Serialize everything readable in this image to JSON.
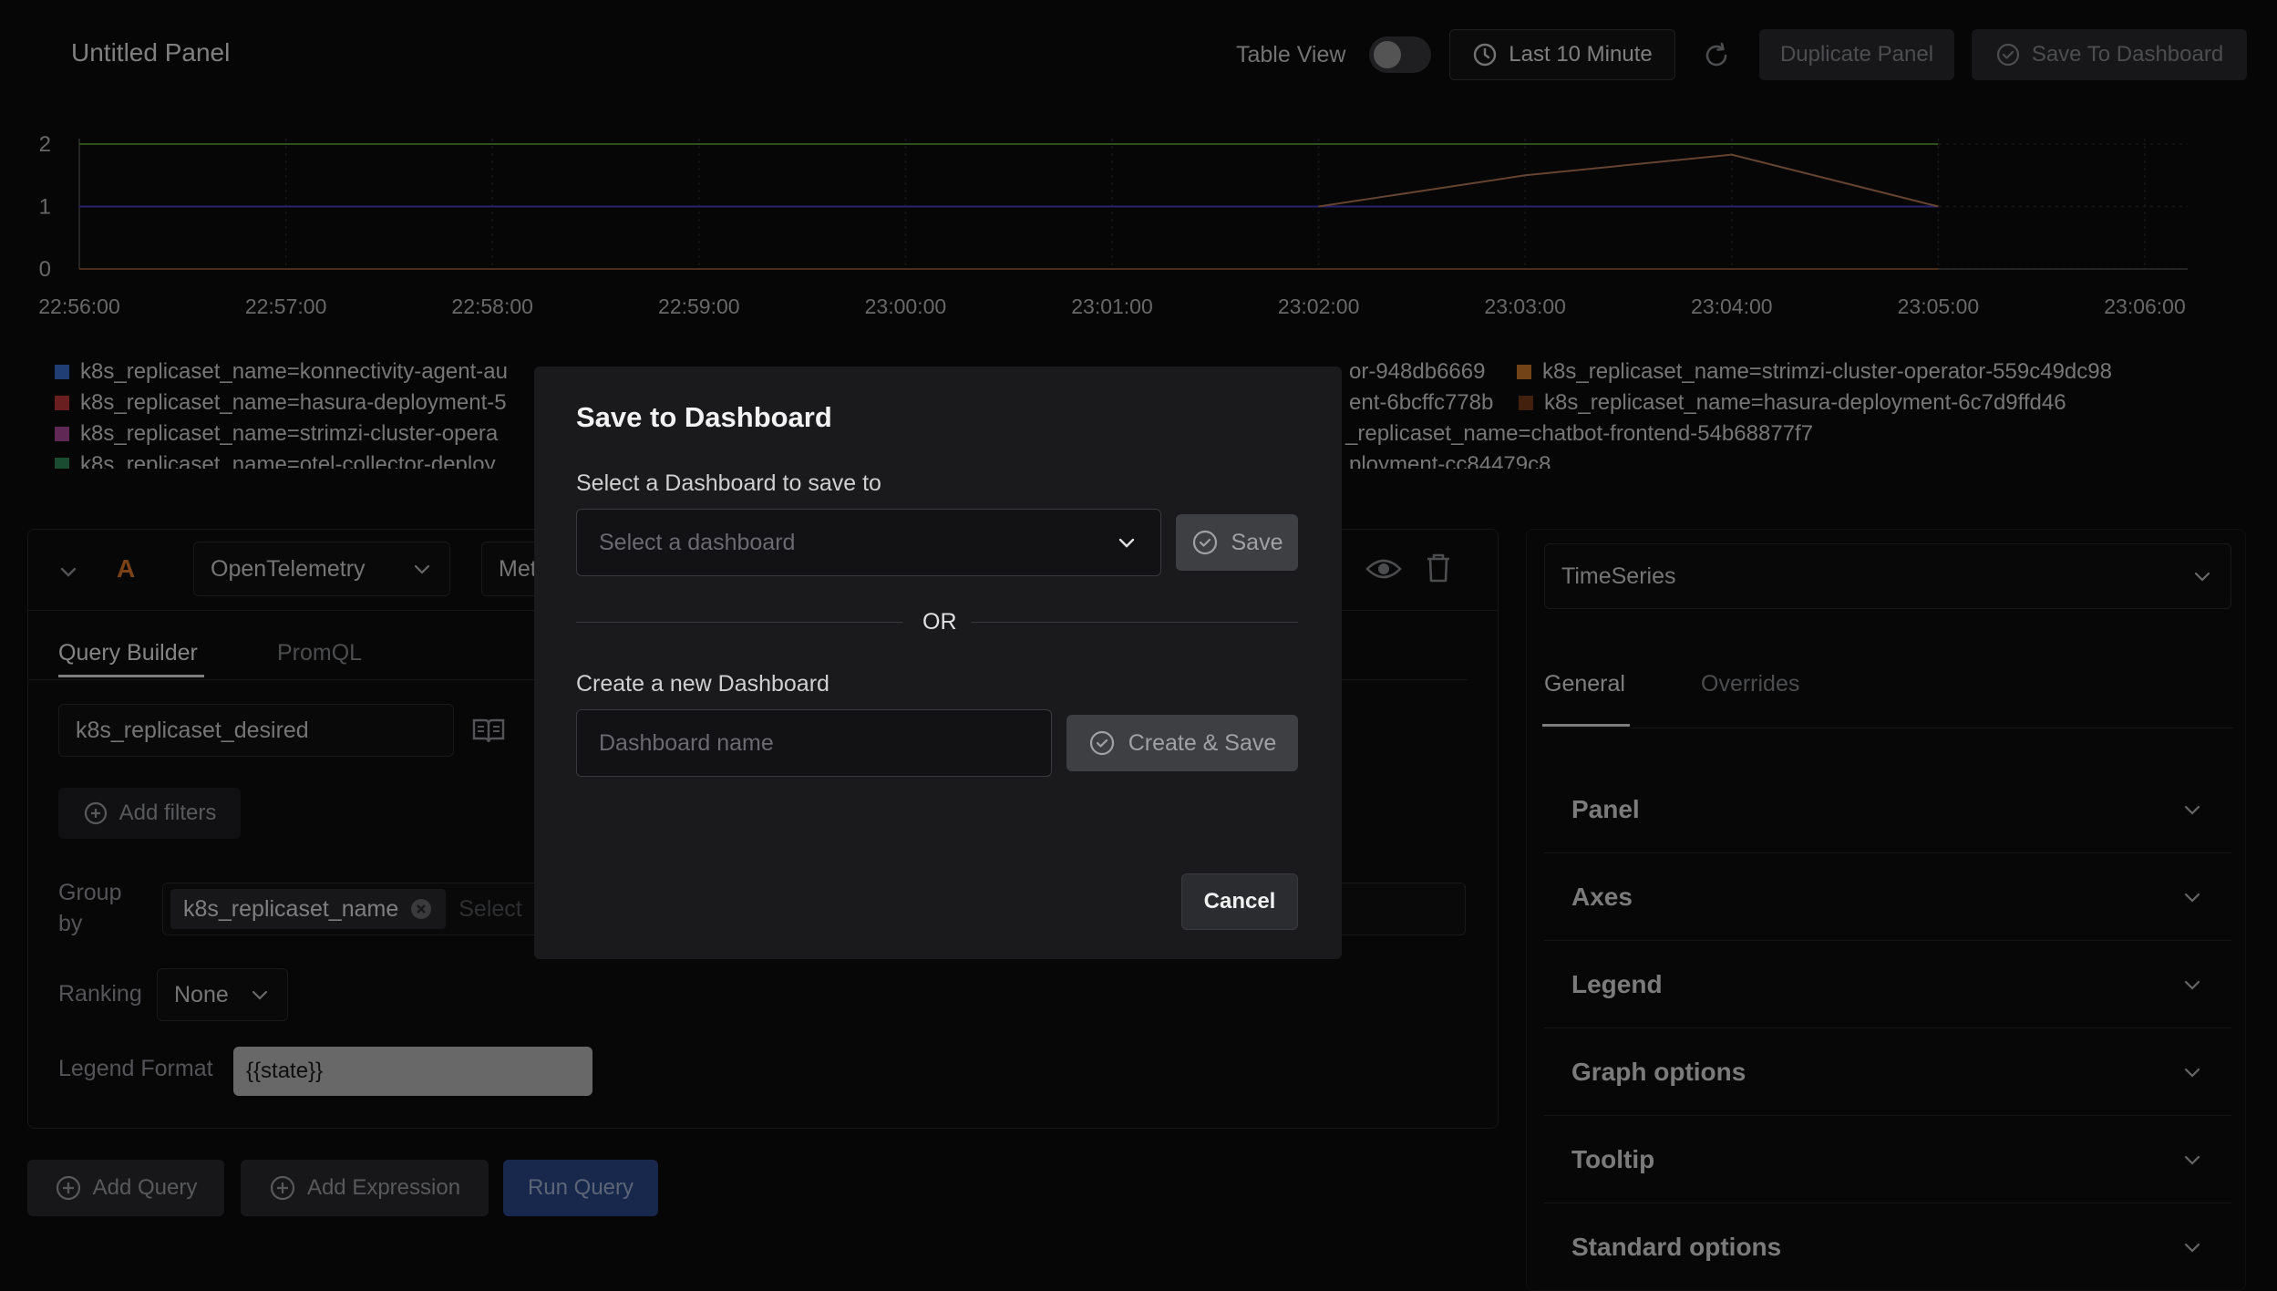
{
  "header": {
    "title": "Untitled Panel",
    "table_view_label": "Table View",
    "time_range": "Last 10 Minute",
    "duplicate_label": "Duplicate Panel",
    "save_label": "Save To Dashboard"
  },
  "chart_data": {
    "type": "line",
    "x": [
      "22:56:00",
      "22:57:00",
      "22:58:00",
      "22:59:00",
      "23:00:00",
      "23:01:00",
      "23:02:00",
      "23:03:00",
      "23:04:00",
      "23:05:00",
      "23:06:00"
    ],
    "y_ticks": [
      "0",
      "1",
      "2"
    ],
    "ylim": [
      0,
      2
    ],
    "series": [
      {
        "color": "#5a8f3a",
        "points": [
          [
            "22:56:00",
            2
          ],
          [
            "23:05:00",
            2
          ]
        ]
      },
      {
        "color": "#4a3cc8",
        "points": [
          [
            "22:56:00",
            1
          ],
          [
            "23:05:00",
            1
          ]
        ]
      },
      {
        "color": "#b87a5a",
        "points": [
          [
            "23:02:00",
            1
          ],
          [
            "23:03:00",
            1.5
          ],
          [
            "23:04:00",
            1.83
          ],
          [
            "23:05:00",
            1
          ]
        ]
      },
      {
        "color": "#8a5030",
        "points": [
          [
            "22:56:00",
            0
          ],
          [
            "23:05:00",
            0
          ]
        ]
      }
    ],
    "legend": [
      {
        "label": "k8s_replicaset_name=konnectivity-agent-au",
        "color": "#3b6fd4"
      },
      {
        "label": "k8s_replicaset_name=hasura-deployment-5",
        "color": "#c0393b"
      },
      {
        "label": "k8s_replicaset_name=strimzi-cluster-opera",
        "color": "#b04a9a"
      },
      {
        "label": "k8s_replicaset_name=otel-collector-deploy",
        "color": "#2e8a5a"
      },
      {
        "label": "or-948db6669",
        "color": ""
      },
      {
        "label": "ent-6bcffc778b",
        "color": ""
      },
      {
        "label": "_replicaset_name=chatbot-frontend-54b68877f7",
        "color": ""
      },
      {
        "label": "ployment-cc84479c8",
        "color": ""
      },
      {
        "label": "k8s_replicaset_name=strimzi-cluster-operator-559c49dc98",
        "color": "#d07a2a"
      },
      {
        "label": "k8s_replicaset_name=hasura-deployment-6c7d9ffd46",
        "color": "#7a3a1a"
      }
    ]
  },
  "query": {
    "letter": "A",
    "datasource": "OpenTelemetry",
    "metric_partial": "Met",
    "tabs": [
      "Query Builder",
      "PromQL"
    ],
    "metric_name": "k8s_replicaset_desired",
    "add_filters": "Add filters",
    "group_by_label": "Group by",
    "group_by_tag": "k8s_replicaset_name",
    "group_by_placeholder": "Select",
    "ranking_label": "Ranking",
    "ranking_value": "None",
    "legend_format_label": "Legend Format",
    "legend_format_value": "{{state}}"
  },
  "footer_buttons": {
    "add_query": "Add Query",
    "add_expression": "Add Expression",
    "run_query": "Run Query"
  },
  "right_panel": {
    "viz_type": "TimeSeries",
    "tabs": [
      "General",
      "Overrides"
    ],
    "sections": [
      "Panel",
      "Axes",
      "Legend",
      "Graph options",
      "Tooltip",
      "Standard options"
    ]
  },
  "modal": {
    "title": "Save to Dashboard",
    "select_label": "Select a Dashboard to save to",
    "select_placeholder": "Select a dashboard",
    "save_button": "Save",
    "or_text": "OR",
    "create_label": "Create a new Dashboard",
    "name_placeholder": "Dashboard name",
    "create_button": "Create & Save",
    "cancel_button": "Cancel"
  }
}
